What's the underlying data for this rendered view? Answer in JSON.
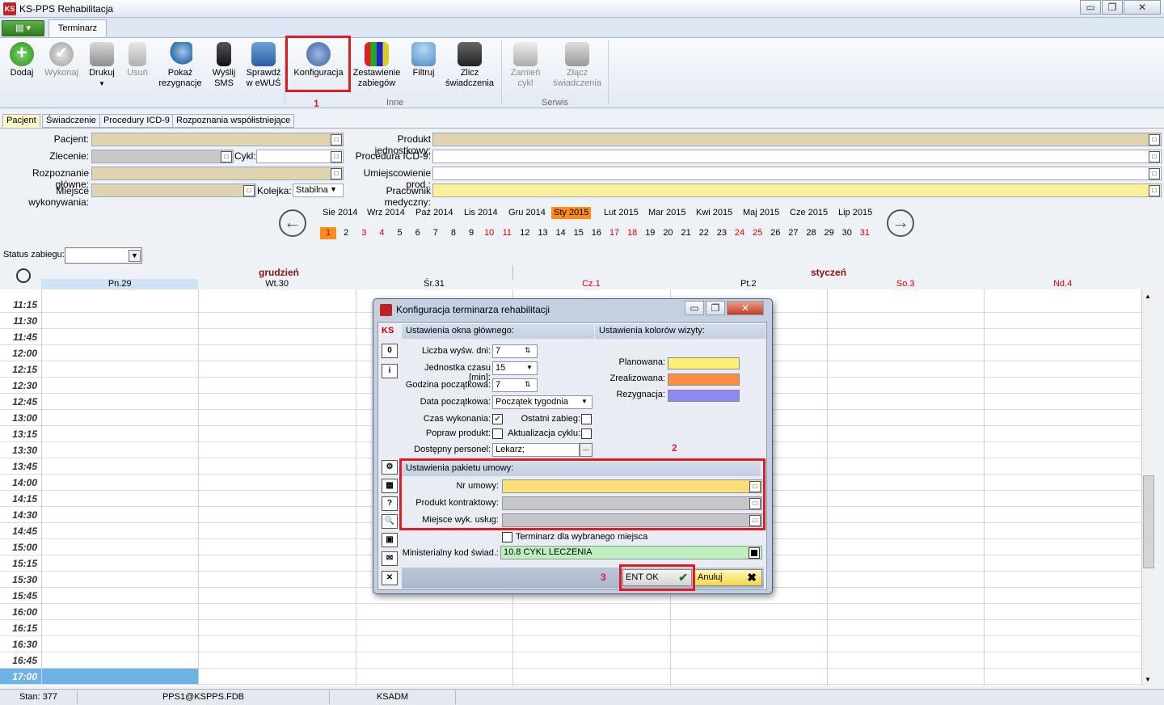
{
  "window": {
    "title": "KS-PPS Rehabilitacja",
    "minimize": "▭",
    "maximize": "❐",
    "close": "✕"
  },
  "ribbon": {
    "tab": "Terminarz",
    "buttons": [
      {
        "label": "Dodaj",
        "icon": "add-icon",
        "enabled": true
      },
      {
        "label": "Wykonaj",
        "icon": "check-icon",
        "enabled": false
      },
      {
        "label": "Drukuj",
        "icon": "printer-icon",
        "enabled": true
      },
      {
        "label": "Usuń",
        "icon": "trash-icon",
        "enabled": false
      },
      {
        "label": "Pokaż rezygnacje",
        "icon": "magnifier-icon",
        "enabled": true
      },
      {
        "label": "Wyślij SMS",
        "icon": "phone-icon",
        "enabled": true
      },
      {
        "label": "Sprawdź w eWUŚ",
        "icon": "doctor-icon",
        "enabled": true
      },
      {
        "label": "Konfiguracja",
        "icon": "gear-icon",
        "enabled": true
      },
      {
        "label": "Zestawienie zabiegów",
        "icon": "chart-icon",
        "enabled": true
      },
      {
        "label": "Filtruj",
        "icon": "filter-icon",
        "enabled": true
      },
      {
        "label": "Zlicz świadczenia",
        "icon": "calculator-icon",
        "enabled": true
      },
      {
        "label": "Zamień cykl",
        "icon": "edit-icon",
        "enabled": false
      },
      {
        "label": "Złącz świadczenia",
        "icon": "merge-icon",
        "enabled": false
      }
    ],
    "groups": {
      "inne": "Inne",
      "serwis": "Serwis"
    },
    "callouts": {
      "one": "1",
      "two": "2",
      "three": "3"
    }
  },
  "patient_tabs": [
    "Pacjent",
    "Świadczenie",
    "Procedury ICD-9",
    "Rozpoznania współistniejące"
  ],
  "form": {
    "pacjent": "Pacjent:",
    "zlecenie": "Zlecenie:",
    "cykl": "Cykl:",
    "rozpoznanie": "Rozpoznanie główne:",
    "miejsce": "Miejsce wykonywania:",
    "kolejka": "Kolejka:",
    "kolejka_value": "Stabilna",
    "produkt": "Produkt jednostkowy:",
    "procedura": "Procedura ICD-9:",
    "umiejscowienie": "Umiejscowienie prod.:",
    "pracownik": "Pracownik medyczny:"
  },
  "calendar": {
    "months": [
      "Sie 2014",
      "Wrz 2014",
      "Paź 2014",
      "Lis 2014",
      "Gru 2014",
      "Sty 2015",
      "Lut 2015",
      "Mar 2015",
      "Kwi 2015",
      "Maj 2015",
      "Cze 2015",
      "Lip 2015"
    ],
    "selected_month": "Sty 2015",
    "days": [
      "1",
      "2",
      "3",
      "4",
      "5",
      "6",
      "7",
      "8",
      "9",
      "10",
      "11",
      "12",
      "13",
      "14",
      "15",
      "16",
      "17",
      "18",
      "19",
      "20",
      "21",
      "22",
      "23",
      "24",
      "25",
      "26",
      "27",
      "28",
      "29",
      "30",
      "31"
    ],
    "red_days": [
      "3",
      "4",
      "10",
      "11",
      "17",
      "18",
      "24",
      "25",
      "31"
    ],
    "selected_day": "1"
  },
  "schedule": {
    "status_label": "Status zabiegu:",
    "month_left": "grudzień",
    "month_right": "styczeń",
    "columns": [
      "Pn.29",
      "Wt.30",
      "Śr.31",
      "Cz.1",
      "Pt.2",
      "So.3",
      "Nd.4"
    ],
    "times": [
      "11:15",
      "11:30",
      "11:45",
      "12:00",
      "12:15",
      "12:30",
      "12:45",
      "13:00",
      "13:15",
      "13:30",
      "13:45",
      "14:00",
      "14:15",
      "14:30",
      "14:45",
      "15:00",
      "15:15",
      "15:30",
      "15:45",
      "16:00",
      "16:15",
      "16:30",
      "16:45",
      "17:00"
    ]
  },
  "statusbar": {
    "stan": "Stan: 377",
    "db": "PPS1@KSPPS.FDB",
    "user": "KSADM"
  },
  "dialog": {
    "title": "Konfiguracja terminarza rehabilitacji",
    "main_section": "Ustawienia okna głównego:",
    "colors_section": "Ustawienia kolorów wizyty:",
    "liczba_dni": "Liczba wyśw. dni:",
    "liczba_dni_value": "7",
    "jednostka": "Jednostka czasu [min]:",
    "jednostka_value": "15",
    "godzina": "Godzina początkowa:",
    "godzina_value": "7",
    "data": "Data początkowa:",
    "data_value": "Początek tygodnia",
    "czas_wykonania": "Czas wykonania:",
    "czas_wykonania_checked": true,
    "ostatni_zabieg": "Ostatni zabieg:",
    "popraw_produkt": "Popraw produkt:",
    "aktualizacja": "Aktualizacja cyklu:",
    "personel": "Dostępny personel:",
    "personel_value": "Lekarz;",
    "planowana": "Planowana:",
    "zrealizowana": "Zrealizowana:",
    "rezygnacja": "Rezygnacja:",
    "colors": {
      "planowana": "#fff176",
      "zrealizowana": "#ff8c42",
      "rezygnacja": "#8c88f5"
    },
    "pakiet_section": "Ustawienia pakietu umowy:",
    "nr_umowy": "Nr umowy:",
    "produkt_kontraktowy": "Produkt kontraktowy:",
    "miejsce_uslug": "Miejsce wyk. usług:",
    "terminarz_miejsca": "Terminarz dla wybranego miejsca",
    "kod_swiad": "Ministerialny kod świad.:",
    "kod_swiad_value": "10.8 CYKL LECZENIA",
    "ok": "ENT OK",
    "cancel": "Anuluj",
    "side_buttons": [
      "0",
      "i",
      "⚙",
      "▦",
      "?",
      "🔍",
      "▣",
      "✉",
      "✕"
    ]
  }
}
